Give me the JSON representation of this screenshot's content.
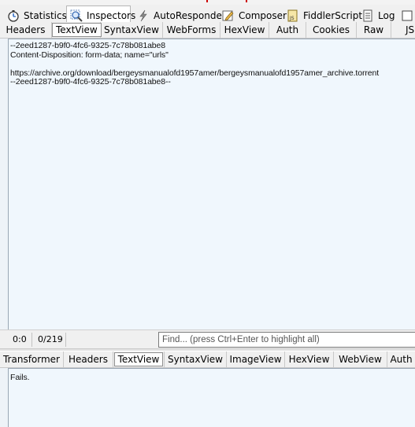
{
  "main_tabs": [
    {
      "label": "Statistics",
      "icon": "stopwatch-icon"
    },
    {
      "label": "Inspectors",
      "icon": "magnifier-icon",
      "active": true
    },
    {
      "label": "AutoResponder",
      "icon": "lightning-icon"
    },
    {
      "label": "Composer",
      "icon": "pencil-icon"
    },
    {
      "label": "FiddlerScript",
      "icon": "script-icon"
    },
    {
      "label": "Log",
      "icon": "log-icon"
    },
    {
      "label": "",
      "icon": "checkbox-icon"
    }
  ],
  "request_tabs": [
    "Headers",
    "TextView",
    "SyntaxView",
    "WebForms",
    "HexView",
    "Auth",
    "Cookies",
    "Raw",
    "JS"
  ],
  "request_active": "TextView",
  "request_body": "--2eed1287-b9f0-4fc6-9325-7c78b081abe8\nContent-Disposition: form-data; name=\"urls\"\n\nhttps://archive.org/download/bergeysmanualofd1957amer/bergeysmanualofd1957amer_archive.torrent\n--2eed1287-b9f0-4fc6-9325-7c78b081abe8--",
  "status": {
    "position": "0:0",
    "count": "0/219",
    "find_placeholder": "Find... (press Ctrl+Enter to highlight all)"
  },
  "response_tabs": [
    "Transformer",
    "Headers",
    "TextView",
    "SyntaxView",
    "ImageView",
    "HexView",
    "WebView",
    "Auth"
  ],
  "response_active": "TextView",
  "response_body": "Fails."
}
